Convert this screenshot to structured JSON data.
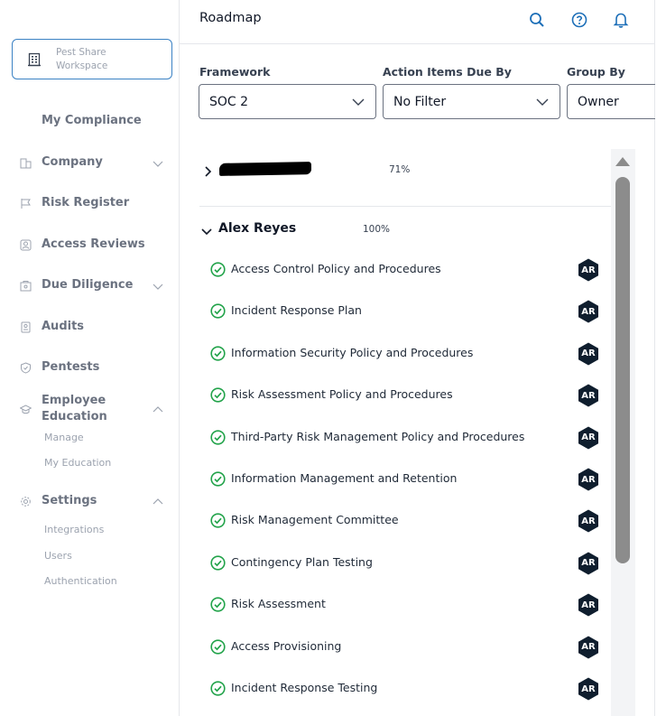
{
  "workspace": {
    "line1": "Pest Share",
    "line2": "Workspace"
  },
  "sidebar": {
    "items": [
      {
        "label": "My Compliance"
      },
      {
        "label": "Company"
      },
      {
        "label": "Risk Register"
      },
      {
        "label": "Access Reviews"
      },
      {
        "label": "Due Diligence"
      },
      {
        "label": "Audits"
      },
      {
        "label": "Pentests"
      },
      {
        "label": "Employee Education"
      },
      {
        "label": "Settings"
      }
    ],
    "education_sub": [
      "Manage",
      "My Education"
    ],
    "settings_sub": [
      "Integrations",
      "Users",
      "Authentication"
    ]
  },
  "header": {
    "title": "Roadmap"
  },
  "filters": {
    "framework": {
      "label": "Framework",
      "value": "SOC 2"
    },
    "due_by": {
      "label": "Action Items Due By",
      "value": "No Filter"
    },
    "group_by": {
      "label": "Group By",
      "value": "Owner"
    }
  },
  "groups": [
    {
      "name": "[redacted]",
      "percent": "71%",
      "expanded": false
    },
    {
      "name": "Alex Reyes",
      "percent": "100%",
      "expanded": true
    }
  ],
  "items": [
    {
      "label": "Access Control Policy and Procedures",
      "owner": "AR"
    },
    {
      "label": "Incident Response Plan",
      "owner": "AR"
    },
    {
      "label": "Information Security Policy and Procedures",
      "owner": "AR"
    },
    {
      "label": "Risk Assessment Policy and Procedures",
      "owner": "AR"
    },
    {
      "label": "Third-Party Risk Management Policy and Procedures",
      "owner": "AR"
    },
    {
      "label": "Information Management and Retention",
      "owner": "AR"
    },
    {
      "label": "Risk Management Committee",
      "owner": "AR"
    },
    {
      "label": "Contingency Plan Testing",
      "owner": "AR"
    },
    {
      "label": "Risk Assessment",
      "owner": "AR"
    },
    {
      "label": "Access Provisioning",
      "owner": "AR"
    },
    {
      "label": "Incident Response Testing",
      "owner": "AR"
    }
  ],
  "colors": {
    "accent": "#1d6fb8",
    "check": "#22a34a",
    "avatar": "#0f1e2e"
  }
}
